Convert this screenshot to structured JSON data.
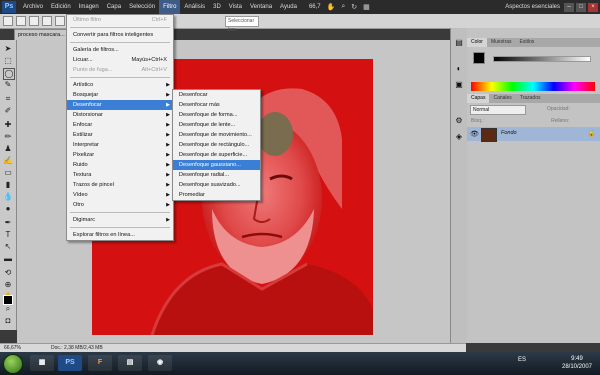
{
  "menubar": {
    "logo": "Ps",
    "items": [
      "Archivo",
      "Edición",
      "Imagen",
      "Capa",
      "Selección",
      "Filtro",
      "Análisis",
      "3D",
      "Vista",
      "Ventana",
      "Ayuda"
    ],
    "zoom": "66,7",
    "workspace": "Aspectos esenciales"
  },
  "options": {
    "estilo_placeholder": "Seleccionar bor."
  },
  "document": {
    "tab": "proceso mascara..."
  },
  "filter_menu": {
    "items": [
      {
        "label": "Último filtro",
        "shortcut": "Ctrl+F",
        "disabled": true
      },
      {
        "label": "Convertir para filtros inteligentes",
        "shortcut": "",
        "disabled": false
      },
      {
        "label": "Galería de filtros...",
        "shortcut": "",
        "disabled": false
      },
      {
        "label": "Licuar...",
        "shortcut": "Mayús+Ctrl+X",
        "disabled": false
      },
      {
        "label": "Punto de fuga...",
        "shortcut": "Alt+Ctrl+V",
        "disabled": true
      },
      {
        "label": "Artístico",
        "sub": true
      },
      {
        "label": "Bosquejar",
        "sub": true
      },
      {
        "label": "Desenfocar",
        "sub": true,
        "selected": true
      },
      {
        "label": "Distorsionar",
        "sub": true
      },
      {
        "label": "Enfocar",
        "sub": true
      },
      {
        "label": "Estilizar",
        "sub": true
      },
      {
        "label": "Interpretar",
        "sub": true
      },
      {
        "label": "Pixelizar",
        "sub": true
      },
      {
        "label": "Ruido",
        "sub": true
      },
      {
        "label": "Textura",
        "sub": true
      },
      {
        "label": "Trazos de pincel",
        "sub": true
      },
      {
        "label": "Vídeo",
        "sub": true
      },
      {
        "label": "Otro",
        "sub": true
      },
      {
        "label": "Digimarc",
        "sub": true
      },
      {
        "label": "Explorar filtros en línea...",
        "shortcut": "",
        "disabled": false
      }
    ]
  },
  "blur_submenu": {
    "items": [
      "Desenfocar",
      "Desenfocar más",
      "Desenfoque de forma...",
      "Desenfoque de lente...",
      "Desenfoque de movimiento...",
      "Desenfoque de rectángulo...",
      "Desenfoque de superficie...",
      "Desenfoque gaussiano...",
      "Desenfoque radial...",
      "Desenfoque suavizado...",
      "Promediar"
    ],
    "selected_index": 7
  },
  "panels": {
    "color_tabs": [
      "Color",
      "Muestras",
      "Estilos"
    ],
    "layers_tabs": [
      "Capas",
      "Canales",
      "Trazados"
    ],
    "blend_mode": "Normal",
    "opacity_label": "Opacidad:",
    "fill_label": "Relleno:",
    "lock_label": "Bloq.:",
    "layer_name": "Fondo"
  },
  "status": {
    "zoom": "66,67%",
    "doc": "Doc.: 2,38 MB/2,43 MB"
  },
  "taskbar": {
    "apps": [
      "PS",
      "F"
    ],
    "language": "ES",
    "time": "9:49",
    "date": "28/10/2007"
  },
  "colors": {
    "image_red": "#d41010",
    "selection_blue": "#3a7fd5"
  }
}
